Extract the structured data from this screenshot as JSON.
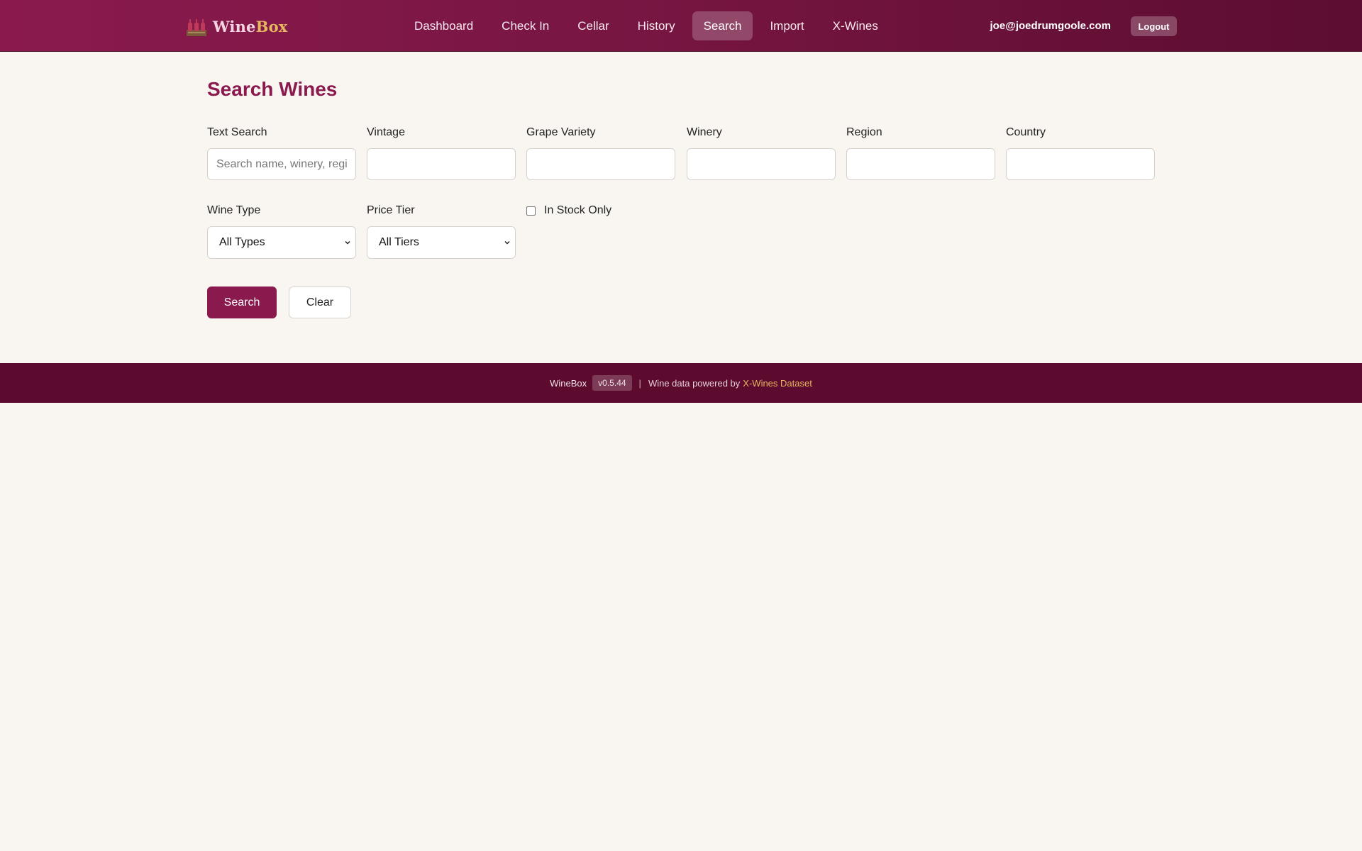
{
  "app": {
    "brand_part1": "Wine",
    "brand_part2": "Box",
    "logo_icon": "wine-bottles-icon"
  },
  "nav": {
    "items": [
      {
        "label": "Dashboard",
        "active": false
      },
      {
        "label": "Check In",
        "active": false
      },
      {
        "label": "Cellar",
        "active": false
      },
      {
        "label": "History",
        "active": false
      },
      {
        "label": "Search",
        "active": true
      },
      {
        "label": "Import",
        "active": false
      },
      {
        "label": "X-Wines",
        "active": false
      }
    ],
    "user_email": "joe@joedrumgoole.com",
    "logout_label": "Logout"
  },
  "page": {
    "title": "Search Wines"
  },
  "filters": {
    "text_search": {
      "label": "Text Search",
      "value": "",
      "placeholder": "Search name, winery, region..."
    },
    "vintage": {
      "label": "Vintage",
      "value": "",
      "placeholder": ""
    },
    "grape": {
      "label": "Grape Variety",
      "value": "",
      "placeholder": ""
    },
    "winery": {
      "label": "Winery",
      "value": "",
      "placeholder": ""
    },
    "region": {
      "label": "Region",
      "value": "",
      "placeholder": ""
    },
    "country": {
      "label": "Country",
      "value": "",
      "placeholder": ""
    },
    "wine_type": {
      "label": "Wine Type",
      "selected": "All Types"
    },
    "price_tier": {
      "label": "Price Tier",
      "selected": "All Tiers"
    },
    "in_stock": {
      "label": "In Stock Only",
      "checked": false
    }
  },
  "actions": {
    "search_label": "Search",
    "clear_label": "Clear"
  },
  "footer": {
    "brand": "WineBox",
    "version": "v0.5.44",
    "separator": "|",
    "powered_text": "Wine data powered by",
    "link_text": "X-Wines Dataset"
  },
  "colors": {
    "primary": "#8a1a4e",
    "footer_bg": "#5c0a2e",
    "accent_gold": "#e7b75f",
    "page_bg": "#f9f6f1"
  }
}
